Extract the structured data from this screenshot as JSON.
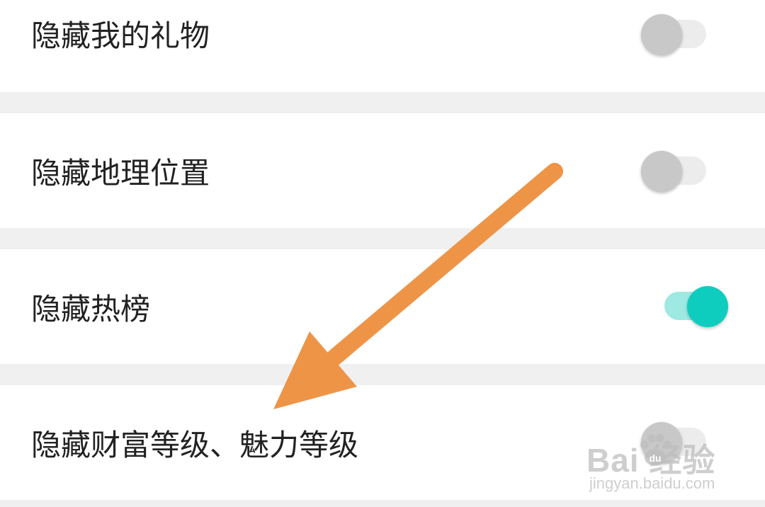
{
  "settings": {
    "items": [
      {
        "label": "隐藏我的礼物",
        "enabled": false
      },
      {
        "label": "隐藏地理位置",
        "enabled": false
      },
      {
        "label": "隐藏热榜",
        "enabled": true
      },
      {
        "label": "隐藏财富等级、魅力等级",
        "enabled": false
      }
    ]
  },
  "annotation": {
    "arrow_color": "#ee9447"
  },
  "watermark": {
    "brand": "Bai  经验",
    "url": "jingyan.baidu.com"
  },
  "colors": {
    "toggle_on_knob": "#0ecdbf",
    "toggle_on_track": "#9ee9e2",
    "toggle_off_knob": "#c8c8c8",
    "toggle_off_track": "#ececec",
    "separator": "#f0f0f0"
  }
}
